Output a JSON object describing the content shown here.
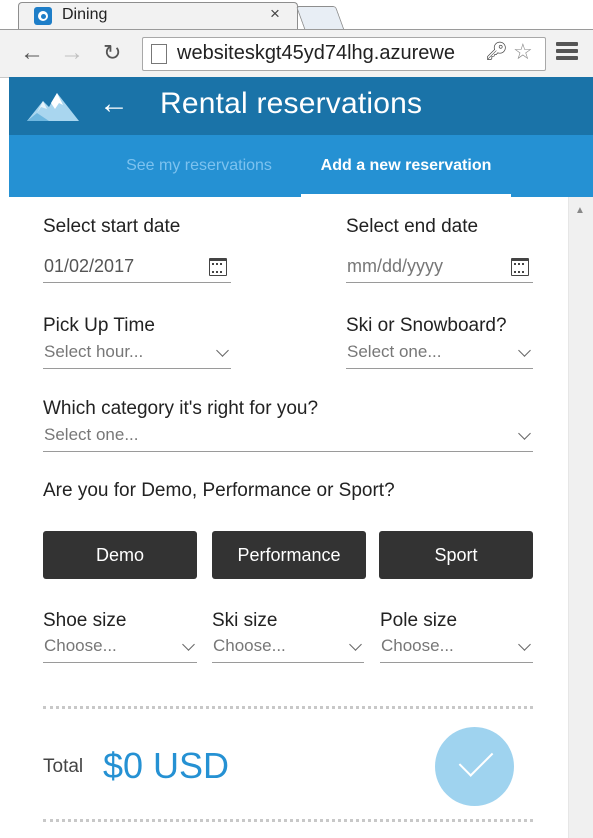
{
  "browser": {
    "tab_title": "Dining",
    "tab_close": "×",
    "url": "websiteskgt45yd74lhg.azurewe"
  },
  "header": {
    "title": "Rental reservations"
  },
  "subnav": {
    "tabs": [
      {
        "label": "See my reservations",
        "active": false
      },
      {
        "label": "Add a new reservation",
        "active": true
      }
    ]
  },
  "form": {
    "start_date": {
      "label": "Select start date",
      "value": "01/02/2017"
    },
    "end_date": {
      "label": "Select end date",
      "placeholder": "mm/dd/yyyy"
    },
    "pickup_time": {
      "label": "Pick Up Time",
      "value": "Select hour..."
    },
    "ski_or_snowboard": {
      "label": "Ski or Snowboard?",
      "value": "Select one..."
    },
    "category": {
      "label": "Which category it's right for you?",
      "value": "Select one..."
    },
    "level_question": "Are you for Demo, Performance or Sport?",
    "level_buttons": [
      "Demo",
      "Performance",
      "Sport"
    ],
    "shoe_size": {
      "label": "Shoe size",
      "value": "Choose..."
    },
    "ski_size": {
      "label": "Ski size",
      "value": "Choose..."
    },
    "pole_size": {
      "label": "Pole size",
      "value": "Choose..."
    }
  },
  "total": {
    "label": "Total",
    "value": "$0 USD"
  },
  "colors": {
    "header": "#1a73a8",
    "subnav": "#2591d3",
    "button": "#333333",
    "accent": "#2591d3",
    "confirm": "#9fd3ef"
  }
}
